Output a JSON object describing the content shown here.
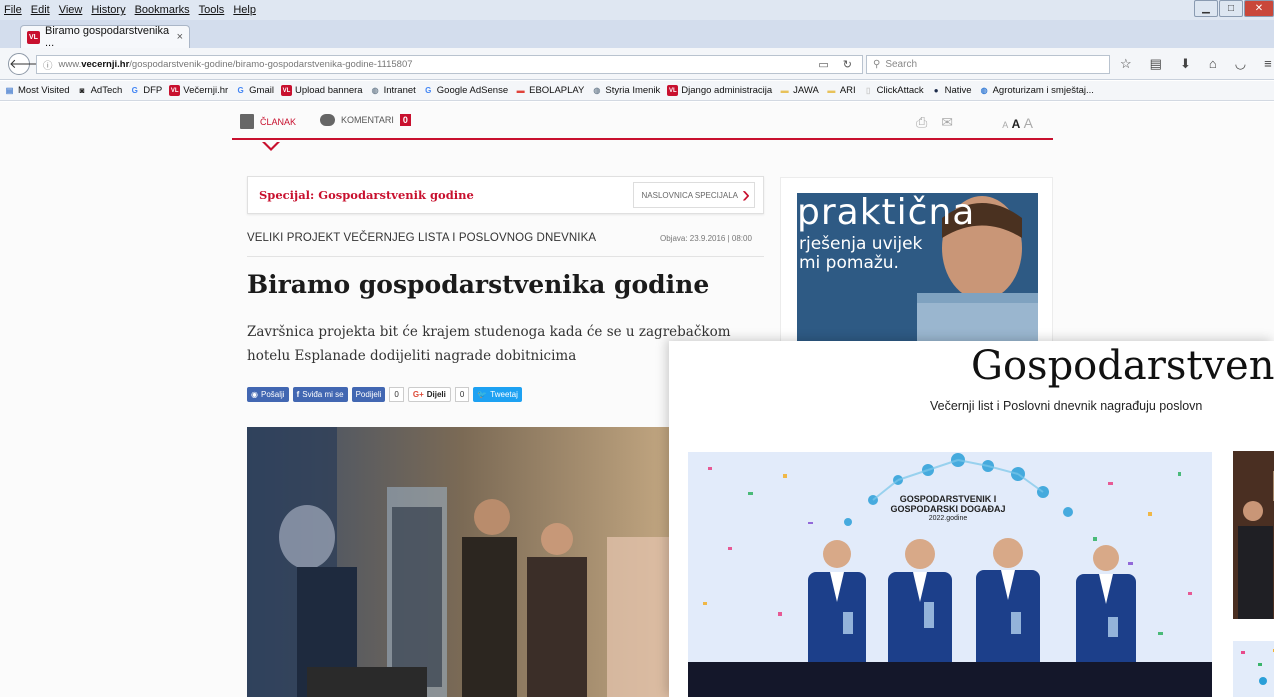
{
  "menubar": {
    "items": [
      "File",
      "Edit",
      "View",
      "History",
      "Bookmarks",
      "Tools",
      "Help"
    ]
  },
  "tab": {
    "title": "Biramo gospodarstvenika ...",
    "close": "×",
    "new_tab": "+",
    "favicon": "VL"
  },
  "navbar": {
    "url_prefix": "www.",
    "url_host": "vecernji.hr",
    "url_path": "/gospodarstvenik-godine/biramo-gospodarstvenika-godine-1115807",
    "search_placeholder": "Search"
  },
  "bookmarks": [
    {
      "label": "Most Visited",
      "icon": "most-visited-icon",
      "color": "#4a7fcf",
      "glyph": "▤"
    },
    {
      "label": "AdTech",
      "icon": "adtech-icon",
      "color": "#222222",
      "glyph": "◙"
    },
    {
      "label": "DFP",
      "icon": "google-icon",
      "color": "#4285f4",
      "glyph": "G"
    },
    {
      "label": "Večernji.hr",
      "icon": "vl-icon",
      "color": "#c8102e",
      "glyph": "VL"
    },
    {
      "label": "Gmail",
      "icon": "google-icon",
      "color": "#4285f4",
      "glyph": "G"
    },
    {
      "label": "Upload bannera",
      "icon": "vl-icon",
      "color": "#c8102e",
      "glyph": "VL"
    },
    {
      "label": "Intranet",
      "icon": "globe-icon",
      "color": "#7a8a99",
      "glyph": "◍"
    },
    {
      "label": "Google AdSense",
      "icon": "google-icon",
      "color": "#4285f4",
      "glyph": "G"
    },
    {
      "label": "EBOLAPLAY",
      "icon": "ebola-icon",
      "color": "#e0433b",
      "glyph": "▬"
    },
    {
      "label": "Styria Imenik",
      "icon": "globe-icon",
      "color": "#7a8a99",
      "glyph": "◍"
    },
    {
      "label": "Django administracija",
      "icon": "vl-icon",
      "color": "#c8102e",
      "glyph": "VL"
    },
    {
      "label": "JAWA",
      "icon": "folder-icon",
      "color": "#e8c25a",
      "glyph": "▬"
    },
    {
      "label": "ARI",
      "icon": "folder-icon",
      "color": "#e8c25a",
      "glyph": "▬"
    },
    {
      "label": "ClickAttack",
      "icon": "page-icon",
      "color": "#cccccc",
      "glyph": "▯"
    },
    {
      "label": "Native",
      "icon": "native-icon",
      "color": "#1c2b4a",
      "glyph": "●"
    },
    {
      "label": "Agroturizam i smještaj...",
      "icon": "globe-icon",
      "color": "#3b7fd6",
      "glyph": "◍"
    }
  ],
  "article_nav": {
    "tab_article": "ČLANAK",
    "tab_comments": "KOMENTARI",
    "comments_count": "0",
    "font_size": {
      "small": "A",
      "medium": "A",
      "large": "A"
    }
  },
  "special": {
    "title": "Specijal: Gospodarstvenik godine",
    "link": "NASLOVNICA SPECIJALA"
  },
  "article": {
    "kicker": "VELIKI PROJEKT VEČERNJEG LISTA I POSLOVNOG DNEVNIKA",
    "published": "Objava: 23.9.2016 | 08:00",
    "headline": "Biramo gospodarstvenika godine",
    "lead": "Završnica projekta bit će krajem studenoga kada će se u zagrebačkom hotelu Esplanade dodijeliti nagrade dobitnicima"
  },
  "social": {
    "send": "Pošalji",
    "like": "Sviđa mi se",
    "share": "Podijeli",
    "share_count": "0",
    "gplus": "Dijeli",
    "gplus_count": "0",
    "tweet": "Tweetaj"
  },
  "ad": {
    "line1": "praktična",
    "line2": "rješenja uvijek",
    "line3": "mi pomažu."
  },
  "overlay": {
    "title": "Gospodarstven",
    "subtitle": "Večernji list i Poslovni dnevnik nagrađuju poslovn",
    "screen_line1": "GOSPODARSTVENIK I",
    "screen_line2": "GOSPODARSKI DOGAĐAJ",
    "screen_line3": "2022.godine"
  },
  "colors": {
    "accent": "#c8102e",
    "facebook": "#4267b2",
    "twitter": "#1da1f2"
  }
}
